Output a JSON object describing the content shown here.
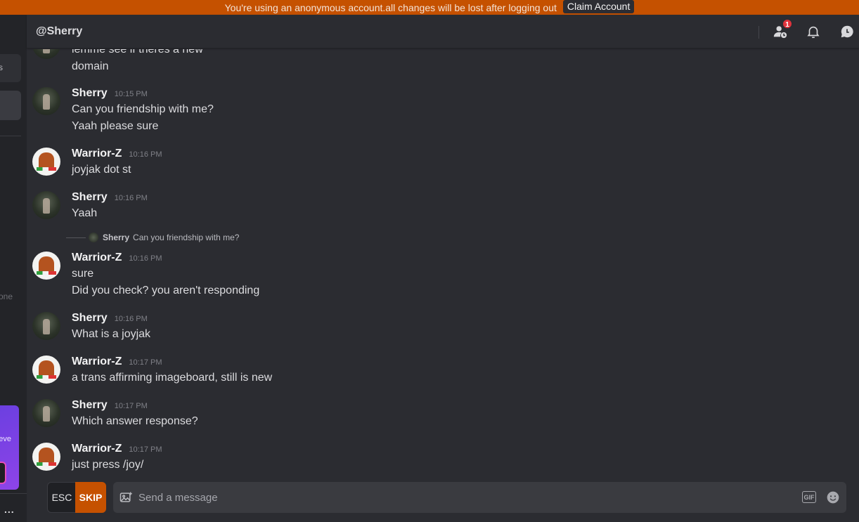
{
  "banner": {
    "text": "You're using an anonymous account.all changes will be lost after logging out",
    "claim_label": "Claim Account"
  },
  "sidebar": {
    "item_fragment": "s",
    "muted_fragment": "one",
    "promo_fragment": "eve",
    "more_label": "..."
  },
  "header": {
    "title": "@Sherry",
    "friend_requests_badge": "1"
  },
  "messages": [
    {
      "lines": [
        "lemme see if theres a new",
        "domain"
      ]
    },
    {
      "author": "Sherry",
      "time": "10:15 PM",
      "lines": [
        "Can you friendship with me?",
        "Yaah please sure"
      ]
    },
    {
      "author": "Warrior-Z",
      "time": "10:16 PM",
      "lines": [
        "joyjak dot st"
      ]
    },
    {
      "author": "Sherry",
      "time": "10:16 PM",
      "lines": [
        "Yaah"
      ]
    },
    {
      "author": "Warrior-Z",
      "time": "10:16 PM",
      "lines": [
        "sure",
        "Did you check? you aren't responding"
      ],
      "reply_to": {
        "author": "Sherry",
        "text": "Can you friendship with me?"
      }
    },
    {
      "author": "Sherry",
      "time": "10:16 PM",
      "lines": [
        "What is a joyjak"
      ]
    },
    {
      "author": "Warrior-Z",
      "time": "10:17 PM",
      "lines": [
        "a trans affirming imageboard, still is new"
      ]
    },
    {
      "author": "Sherry",
      "time": "10:17 PM",
      "lines": [
        "Which answer response?"
      ]
    },
    {
      "author": "Warrior-Z",
      "time": "10:17 PM",
      "lines": [
        "just press /joy/"
      ]
    }
  ],
  "composer": {
    "esc_label": "ESC",
    "skip_label": "SKIP",
    "placeholder": "Send a message",
    "gif_label": "GIF"
  },
  "colors": {
    "accent": "#c55100",
    "background": "#2b2c31",
    "sidebar": "#232428",
    "badge": "#e0333c"
  }
}
